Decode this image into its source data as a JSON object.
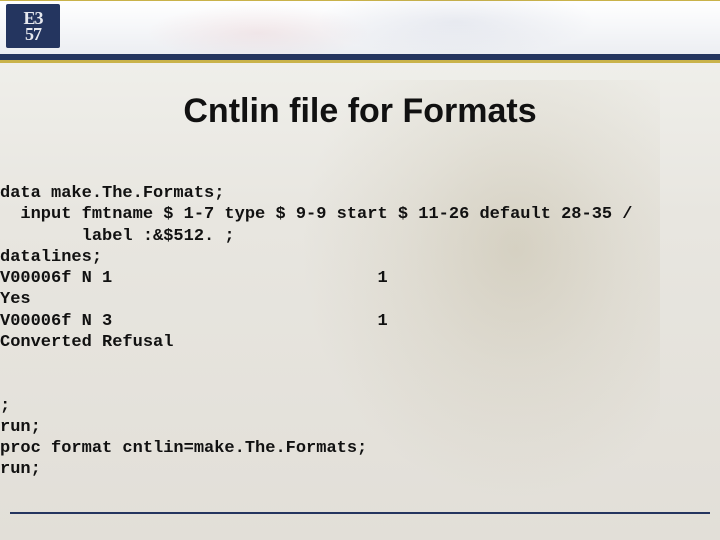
{
  "logo": {
    "top": "E3",
    "bottom": "57"
  },
  "title": "Cntlin file for Formats",
  "code_lines": [
    "data make.The.Formats;",
    "  input fmtname $ 1-7 type $ 9-9 start $ 11-26 default 28-35 /",
    "        label :&$512. ;",
    "datalines;",
    "V00006f N 1                          1",
    "Yes",
    "V00006f N 3                          1",
    "Converted Refusal",
    "",
    "",
    ";",
    "run;",
    "proc format cntlin=make.The.Formats;",
    "run;"
  ]
}
